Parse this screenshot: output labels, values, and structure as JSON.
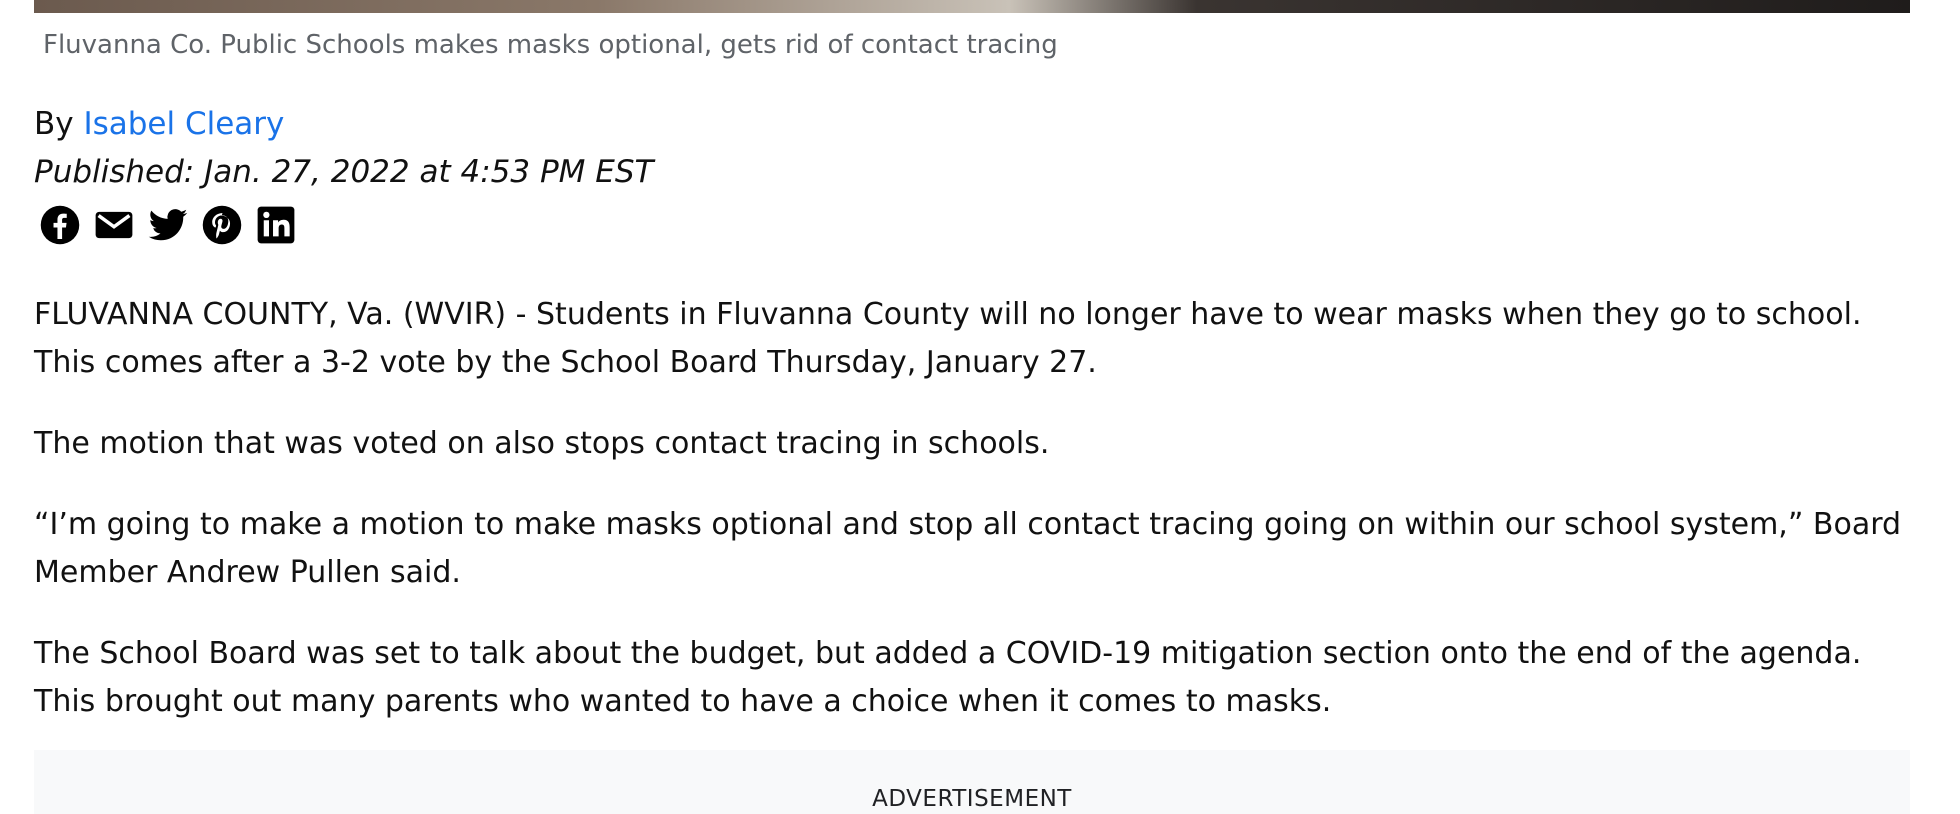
{
  "article": {
    "caption": "Fluvanna Co. Public Schools makes masks optional, gets rid of contact tracing",
    "byline_prefix": "By ",
    "author": "Isabel Cleary",
    "published": "Published: Jan. 27, 2022 at 4:53 PM EST",
    "paragraphs": [
      "FLUVANNA COUNTY, Va. (WVIR) - Students in Fluvanna County will no longer have to wear masks when they go to school. This comes after a 3-2 vote by the School Board Thursday, January 27.",
      "The motion that was voted on also stops contact tracing in schools.",
      "“I’m going to make a motion to make masks optional and stop all contact tracing going on within our school system,” Board Member Andrew Pullen said.",
      "The School Board was set to talk about the budget, but added a COVID-19 mitigation section onto the end of the agenda. This brought out many parents who wanted to have a choice when it comes to masks."
    ]
  },
  "share": {
    "icons": [
      "facebook-icon",
      "email-icon",
      "twitter-icon",
      "pinterest-icon",
      "linkedin-icon"
    ]
  },
  "ad": {
    "label": "ADVERTISEMENT"
  },
  "colors": {
    "link": "#1a73e8",
    "caption": "#5f6368",
    "text": "#111111",
    "ad_background": "#f8f9fa"
  }
}
